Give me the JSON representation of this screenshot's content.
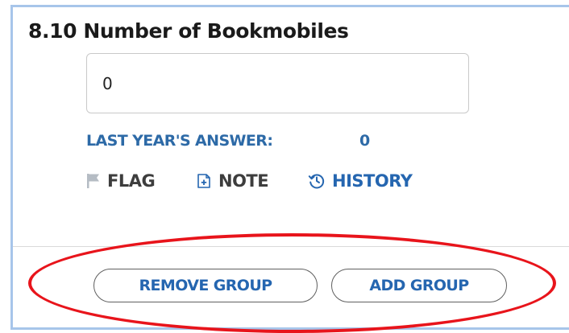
{
  "question": {
    "number": "8.10",
    "title": "8.10 Number of Bookmobiles"
  },
  "answer": {
    "value": "0"
  },
  "last_year": {
    "label": "LAST YEAR'S ANSWER:",
    "value": "0"
  },
  "actions": {
    "flag": {
      "label": "FLAG",
      "icon": "flag-icon"
    },
    "note": {
      "label": "NOTE",
      "icon": "note-icon"
    },
    "history": {
      "label": "HISTORY",
      "icon": "history-icon"
    }
  },
  "group_buttons": {
    "remove_label": "REMOVE GROUP",
    "add_label": "ADD GROUP"
  },
  "colors": {
    "accent_blue": "#2566b0",
    "label_blue": "#2d6aa7",
    "card_border": "#a7c5ea",
    "annotation_red": "#e8141b",
    "flag_gray": "#b5bcc4"
  }
}
